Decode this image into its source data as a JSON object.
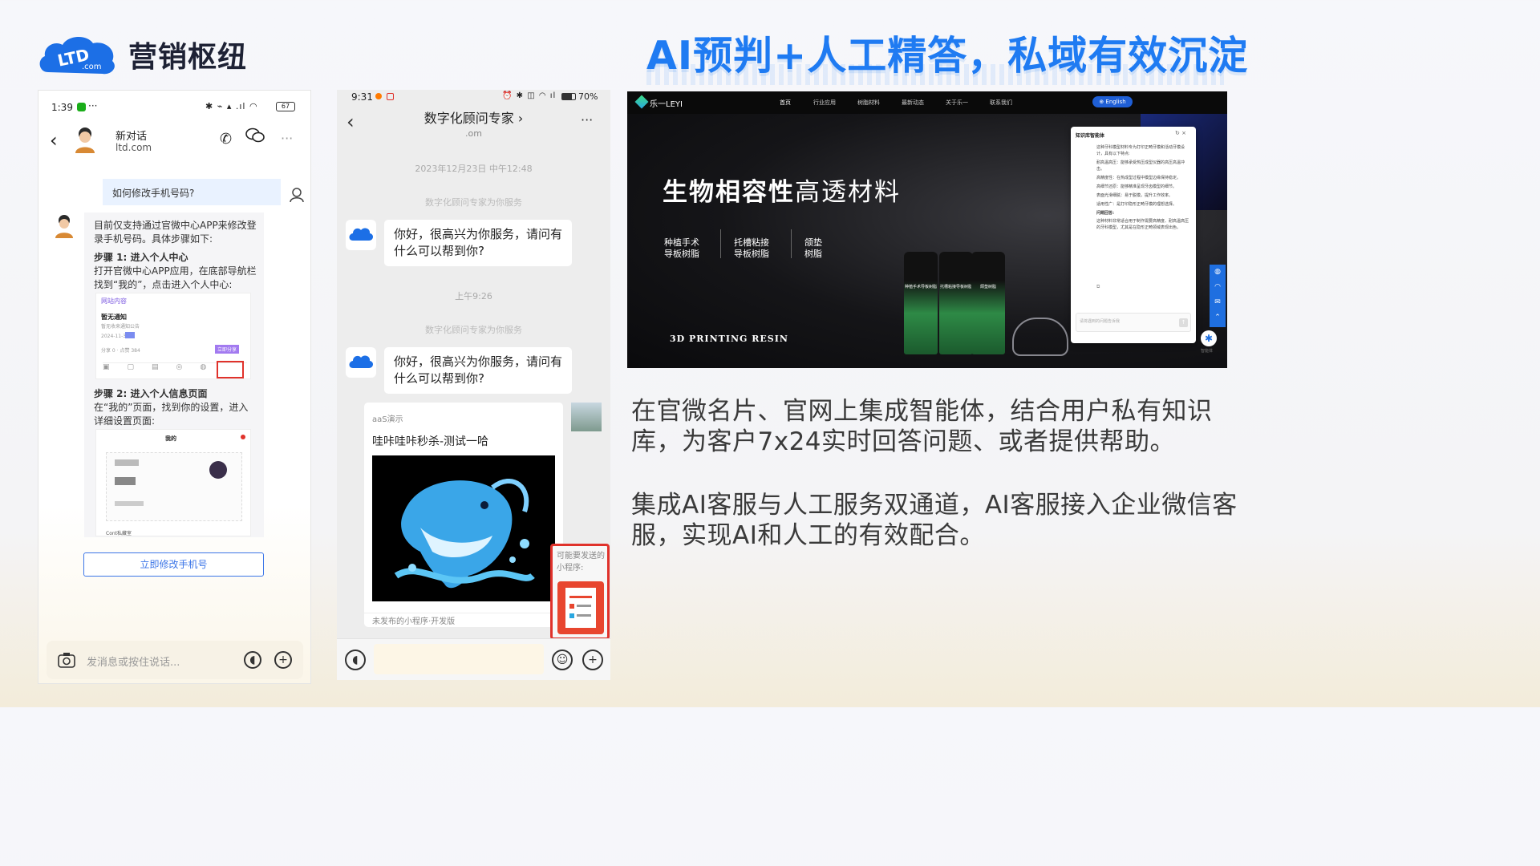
{
  "header": {
    "logo_text": "LTD",
    "logo_sub": ".com",
    "brand": "营销枢纽",
    "headline": "AI预判+人工精答，私域有效沉淀"
  },
  "phone1": {
    "status_time": "1:39",
    "status_dots": "···",
    "status_battery": "67",
    "chat_name": "新对话",
    "chat_sub": "ltd.com",
    "question": "如何修改手机号码?",
    "answer_intro": "目前仅支持通过官微中心APP来修改登录手机号码。具体步骤如下:",
    "step1_title": "步骤 1: 进入个人中心",
    "step1_text": "打开官微中心APP应用，在底部导航栏找到“我的”，点击进入个人中心:",
    "shot1_header": "网站内容",
    "shot1_title": "暂无通知",
    "shot1_sub": "暂无收来通知公告",
    "shot1_row": "2024-11-30",
    "shot1_stats": "分享 0 · 点赞 384",
    "shot1_tag": "立即分享",
    "step2_title": "步骤 2: 进入个人信息页面",
    "step2_text": "在“我的”页面，找到你的设置，进入详细设置页面:",
    "shot2_header": "我的",
    "shot2_footer": "Cont私藏室",
    "change_button": "立即修改手机号",
    "input_placeholder": "发消息或按住说话..."
  },
  "phone2": {
    "status_time": "9:31",
    "status_battery": "70%",
    "title": "数字化顾问专家",
    "subtitle": ".om",
    "timestamp1": "2023年12月23日 中午12:48",
    "service_note1": "数字化顾问专家为你服务",
    "greeting1": "你好，很高兴为你服务，请问有什么可以帮到你?",
    "timestamp2": "上午9:26",
    "service_note2": "数字化顾问专家为你服务",
    "greeting2": "你好，很高兴为你服务，请问有什么可以帮到你?",
    "card_source": "aaS演示",
    "card_title": "哇咔哇咔秒杀-测试一哈",
    "card_footer": "未发布的小程序·开发版",
    "mini_prompt": "可能要发送的小程序:"
  },
  "website": {
    "logo": "乐一LEYI",
    "nav": [
      "首页",
      "行业应用",
      "树脂材料",
      "最新动态",
      "关于乐一",
      "联系我们"
    ],
    "lang": "English",
    "hero_bold": "生物相容性",
    "hero_light": "高透材料",
    "cats": [
      "种植手术导板树脂",
      "托槽粘接导板树脂",
      "颌垫树脂"
    ],
    "tagline": "3D PRINTING RESIN",
    "bottle_labels": [
      "种植手术导板树脂",
      "托槽粘接导板树脂",
      "颌垫树脂"
    ],
    "kb_title": "知识库智能体",
    "kb_lines": [
      "这种牙科模型材料专为打印正畸牙模和活动牙模设计，具有以下特点:",
      "耐高温高压：能够承受热压成型仪器的高压高温冲击。",
      "高精度性：在热成型过程中模型边缘保持稳定。",
      "高细节还原：能够精准呈现牙齿模型的细节。",
      "表面光滑细腻：易于脱模，提升工作效率。",
      "适用性广：是打印隐形正畸牙模的理想选择。",
      "问题回答:",
      "这种材料非常适合用于制作需要高精度、耐高温高压的牙科模型，尤其是在隐形正畸领域表现出色。"
    ],
    "kb_input": "请将遇到的问题告诉我",
    "side_label": "智能体"
  },
  "body": {
    "para1": "在官微名片、官网上集成智能体，结合用户私有知识库，为客户7x24实时回答问题、或者提供帮助。",
    "para2": "集成AI客服与人工服务双通道，AI客服接入企业微信客服，实现AI和人工的有效配合。"
  },
  "colors": {
    "accent": "#1f7bf2",
    "brand_dark": "#1e2235",
    "body_text": "#3a3a3a",
    "highlight_red": "#e0322b",
    "link_blue": "#3c76e8"
  }
}
